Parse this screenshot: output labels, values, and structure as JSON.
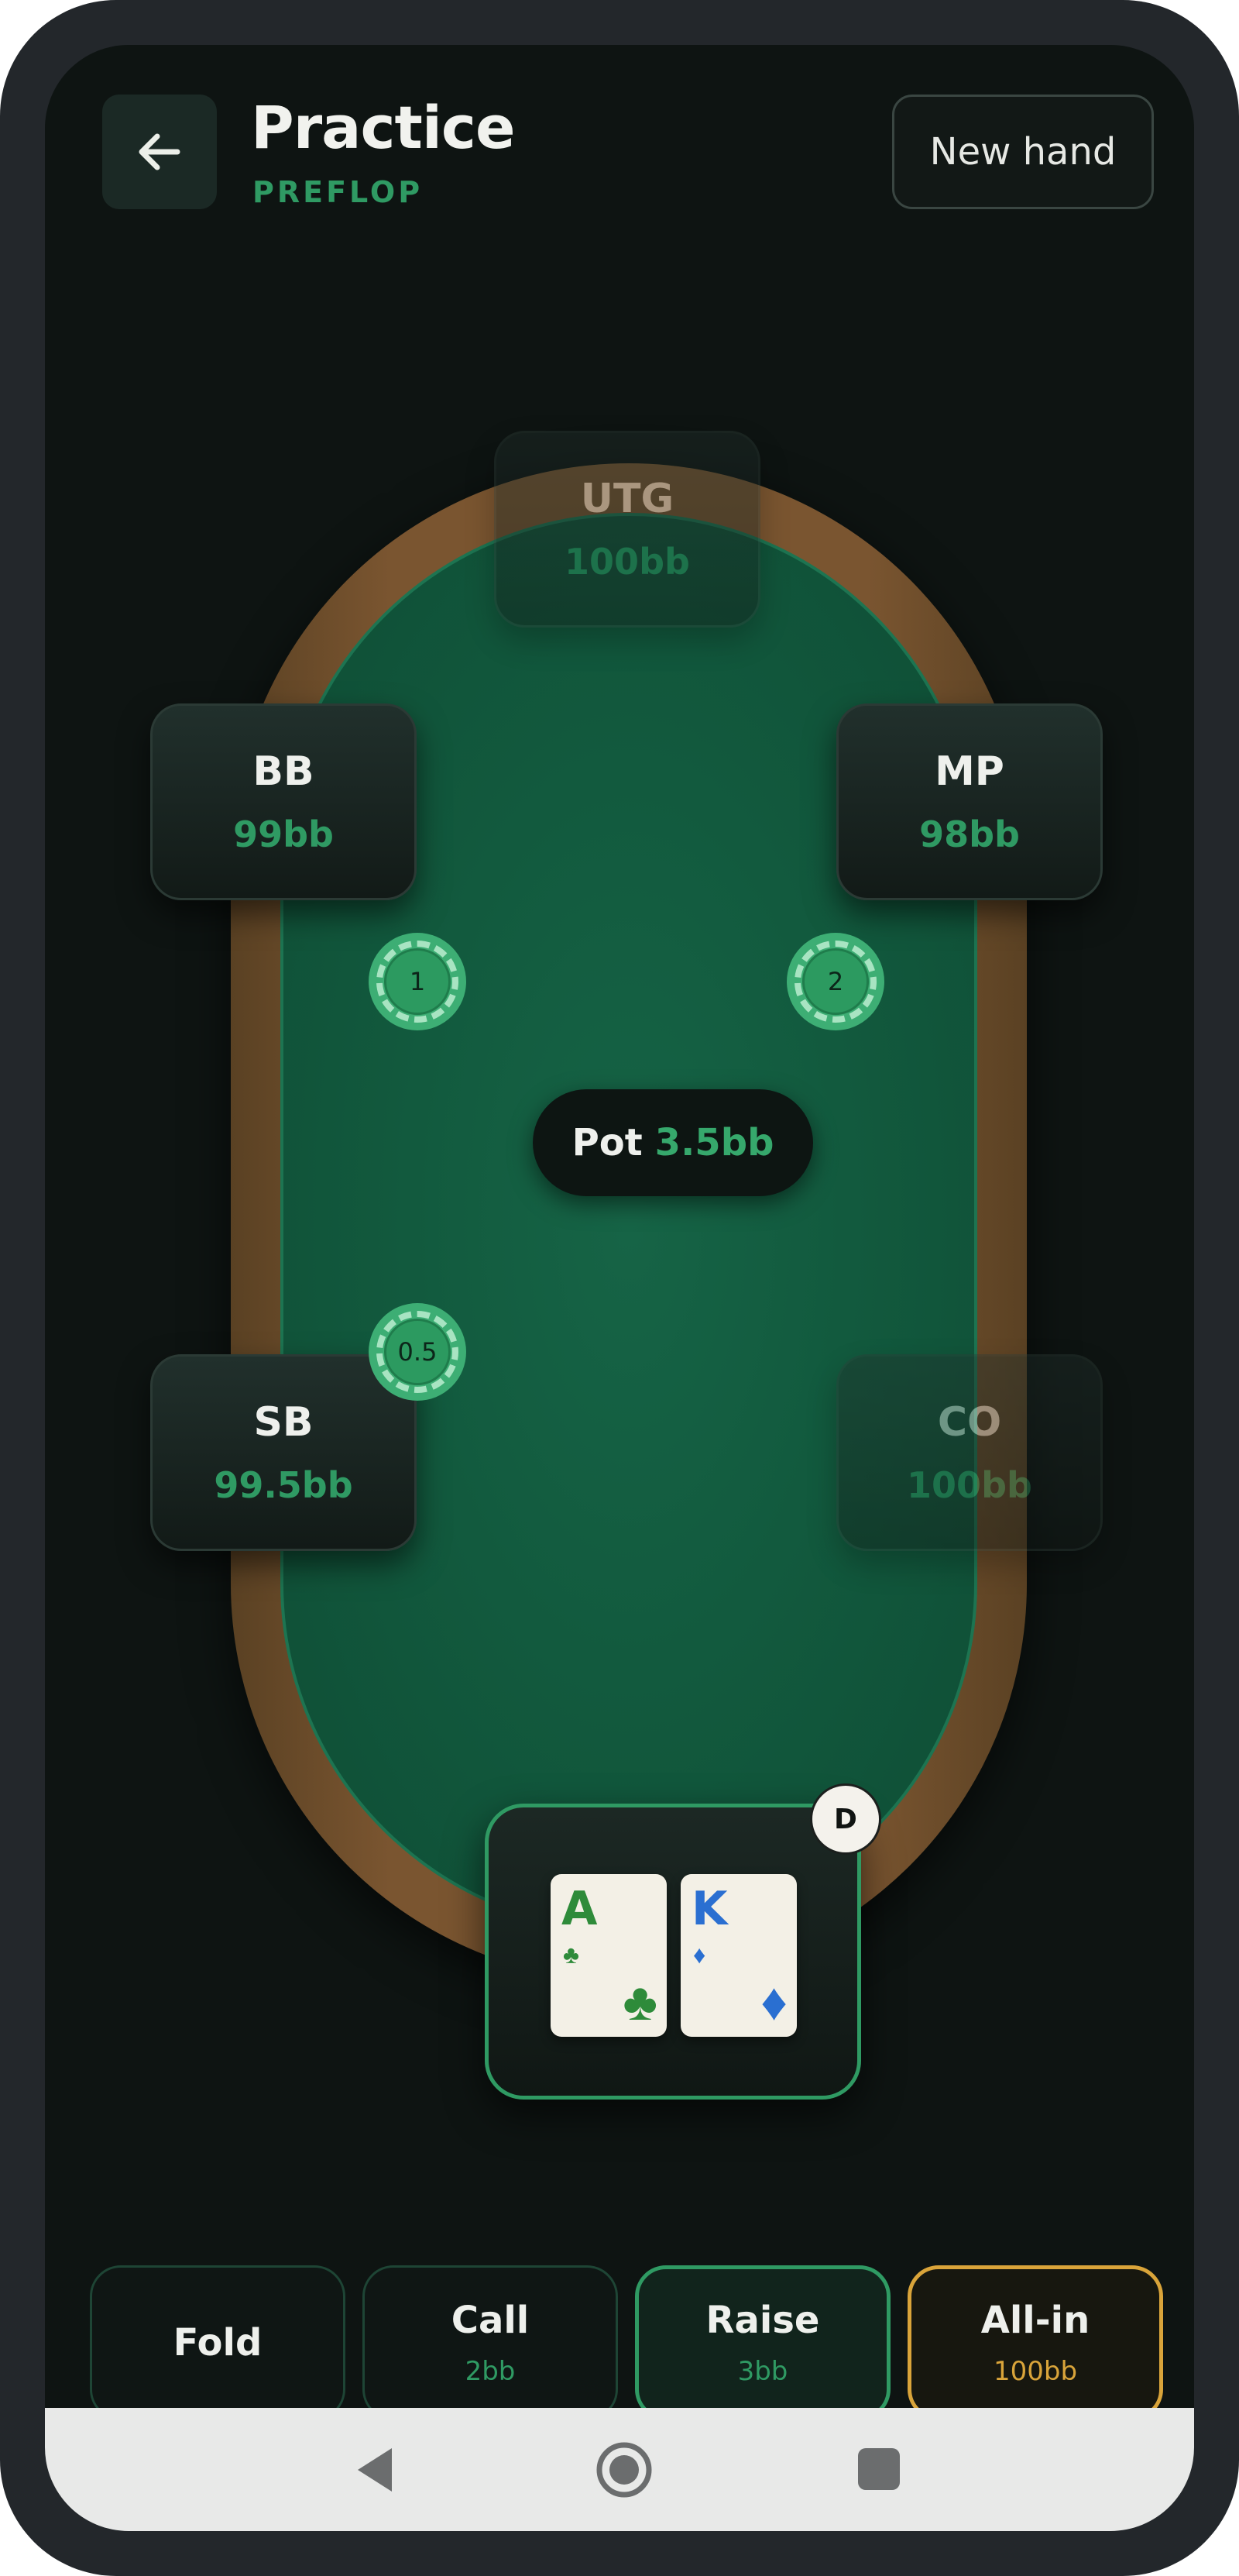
{
  "header": {
    "title": "Practice",
    "street": "PREFLOP",
    "new_hand_label": "New hand"
  },
  "seats": {
    "utg": {
      "name": "UTG",
      "stack": "100bb"
    },
    "bb": {
      "name": "BB",
      "stack": "99bb"
    },
    "mp": {
      "name": "MP",
      "stack": "98bb"
    },
    "sb": {
      "name": "SB",
      "stack": "99.5bb"
    },
    "co": {
      "name": "CO",
      "stack": "100bb"
    }
  },
  "bets": {
    "bb": "1",
    "mp": "2",
    "sb": "0.5"
  },
  "pot": {
    "label": "Pot",
    "value": "3.5bb"
  },
  "hero": {
    "dealer_button": "D",
    "cards": [
      {
        "rank": "A",
        "suit": "♣",
        "color": "#2e8b3a"
      },
      {
        "rank": "K",
        "suit": "♦",
        "color": "#2a6fd1"
      }
    ]
  },
  "actions": {
    "fold": {
      "label": "Fold"
    },
    "call": {
      "label": "Call",
      "amount": "2bb"
    },
    "raise": {
      "label": "Raise",
      "amount": "3bb"
    },
    "allin": {
      "label": "All-in",
      "amount": "100bb"
    }
  },
  "colors": {
    "accent_green": "#2f9a63",
    "allin_gold": "#d9a43a",
    "felt": "#125a3e"
  },
  "icons": {
    "back": "arrow-left-icon",
    "nav_back": "triangle-back-icon",
    "nav_home": "circle-home-icon",
    "nav_recent": "square-recent-icon"
  }
}
